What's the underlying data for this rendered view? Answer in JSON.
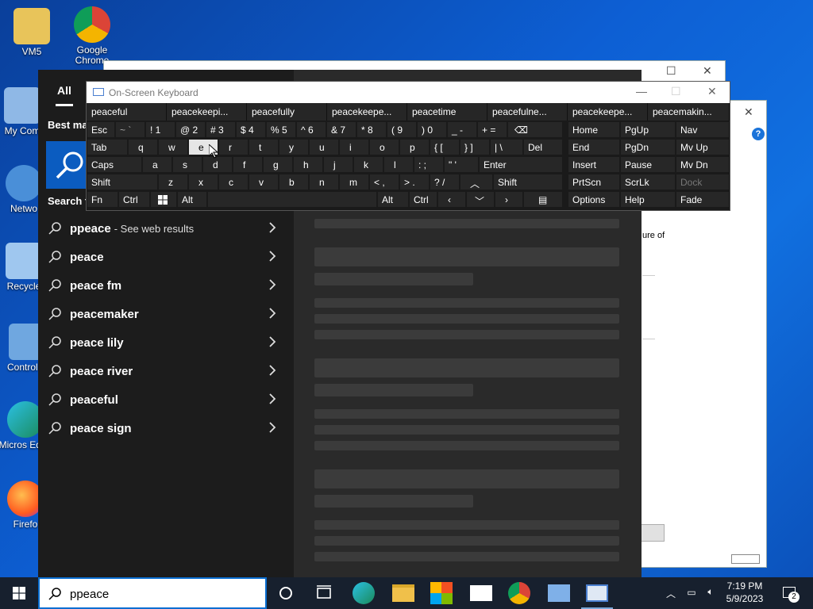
{
  "desktop": {
    "icons": [
      {
        "label": "VM5"
      },
      {
        "label": "Google Chrome"
      },
      {
        "label": "My Com"
      },
      {
        "label": "Netwo"
      },
      {
        "label": "Recycle"
      },
      {
        "label": "Control P"
      },
      {
        "label": "Micros Edge"
      },
      {
        "label": "Firefo"
      }
    ]
  },
  "background_window": {
    "text_fragment": "ure of"
  },
  "search_panel": {
    "tab_all": "All",
    "best_match_label": "Best ma",
    "search_web_label": "Search t",
    "suggestions": [
      {
        "text": "ppeace",
        "sub": "- See web results"
      },
      {
        "text": "peace",
        "sub": ""
      },
      {
        "text": "peace fm",
        "sub": ""
      },
      {
        "text": "peacemaker",
        "sub": ""
      },
      {
        "text": "peace lily",
        "sub": ""
      },
      {
        "text": "peace river",
        "sub": ""
      },
      {
        "text": "peaceful",
        "sub": ""
      },
      {
        "text": "peace sign",
        "sub": ""
      }
    ]
  },
  "osk": {
    "title": "On-Screen Keyboard",
    "predictions": [
      "peaceful",
      "peacekeepi...",
      "peacefully",
      "peacekeepe...",
      "peacetime",
      "peacefulne...",
      "peacekeepe...",
      "peacemakin..."
    ],
    "rows": {
      "r1": [
        "Esc",
        "~ `",
        "! 1",
        "@ 2",
        "# 3",
        "$ 4",
        "% 5",
        "^ 6",
        "& 7",
        "* 8",
        "( 9",
        ") 0",
        "_ -",
        "+ ="
      ],
      "r2": [
        "Tab",
        "q",
        "w",
        "e",
        "r",
        "t",
        "y",
        "u",
        "i",
        "o",
        "p",
        "{ [",
        "} ]",
        "| \\",
        "Del"
      ],
      "r3": [
        "Caps",
        "a",
        "s",
        "d",
        "f",
        "g",
        "h",
        "j",
        "k",
        "l",
        ": ;",
        "\" '",
        "Enter"
      ],
      "r4": [
        "Shift",
        "z",
        "x",
        "c",
        "v",
        "b",
        "n",
        "m",
        "< ,",
        "> .",
        "? /",
        "Shift"
      ],
      "r5": [
        "Fn",
        "Ctrl",
        "Alt",
        "Alt",
        "Ctrl"
      ]
    },
    "side": {
      "home": "Home",
      "pgup": "PgUp",
      "nav": "Nav",
      "end": "End",
      "pgdn": "PgDn",
      "mvup": "Mv Up",
      "insert": "Insert",
      "pause": "Pause",
      "mvdn": "Mv Dn",
      "prtscn": "PrtScn",
      "scrlk": "ScrLk",
      "dock": "Dock",
      "options": "Options",
      "help": "Help",
      "fade": "Fade"
    }
  },
  "taskbar": {
    "search_value": "ppeace",
    "time": "7:19 PM",
    "date": "5/9/2023",
    "notifications": "2"
  },
  "colors": {
    "accent": "#0a6ed1",
    "panel": "#1f1f1f",
    "taskbar": "#17202e"
  }
}
